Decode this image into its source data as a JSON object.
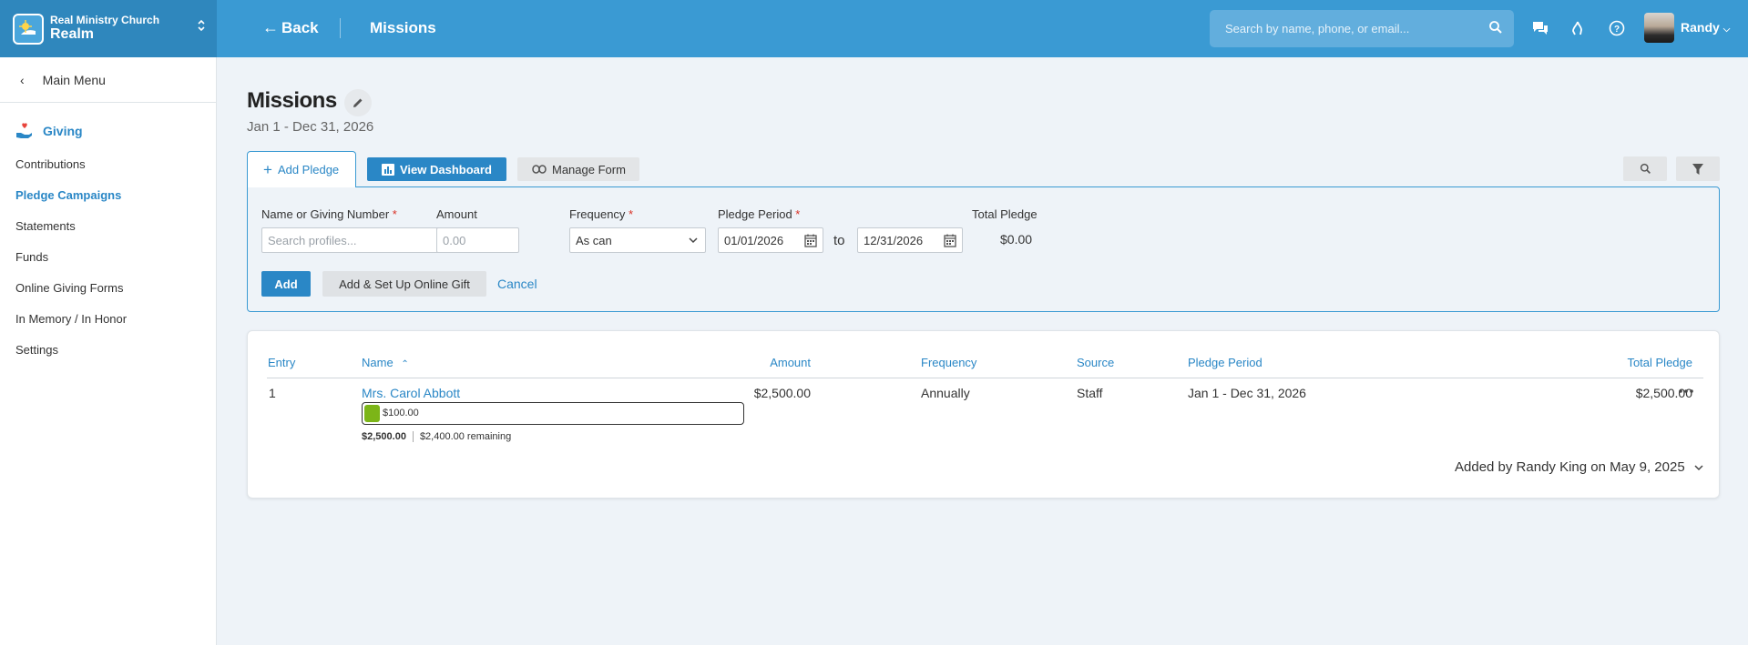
{
  "brand": {
    "org": "Real Ministry Church",
    "name": "Realm"
  },
  "topbar": {
    "back_label": "Back",
    "breadcrumb": "Missions",
    "search_placeholder": "Search by name, phone, or email...",
    "user_name": "Randy",
    "icons": [
      "message-icon",
      "prayer-hands-icon",
      "help-icon"
    ]
  },
  "sidebar": {
    "main_menu": "Main Menu",
    "section": "Giving",
    "items": [
      {
        "label": "Contributions"
      },
      {
        "label": "Pledge Campaigns",
        "active": true
      },
      {
        "label": "Statements"
      },
      {
        "label": "Funds"
      },
      {
        "label": "Online Giving Forms"
      },
      {
        "label": "In Memory / In Honor"
      },
      {
        "label": "Settings"
      }
    ]
  },
  "page": {
    "title": "Missions",
    "subtitle": "Jan 1 - Dec 31, 2026"
  },
  "toolbar": {
    "add_pledge": "Add Pledge",
    "view_dashboard": "View Dashboard",
    "manage_form": "Manage Form"
  },
  "form": {
    "name_label": "Name or Giving Number",
    "name_placeholder": "Search profiles...",
    "amount_label": "Amount",
    "amount_placeholder": "0.00",
    "frequency_label": "Frequency",
    "frequency_value": "As can",
    "period_label": "Pledge Period",
    "period_start": "01/01/2026",
    "to_label": "to",
    "period_end": "12/31/2026",
    "total_label": "Total Pledge",
    "total_value": "$0.00",
    "add_button": "Add",
    "add_setup_button": "Add & Set Up Online Gift",
    "cancel_button": "Cancel",
    "required_mark": "*"
  },
  "table": {
    "headers": {
      "entry": "Entry",
      "name": "Name",
      "amount": "Amount",
      "frequency": "Frequency",
      "source": "Source",
      "period": "Pledge Period",
      "total": "Total Pledge"
    },
    "rows": [
      {
        "entry": "1",
        "name": "Mrs. Carol Abbott",
        "amount": "$2,500.00",
        "frequency": "Annually",
        "source": "Staff",
        "period": "Jan 1 - Dec 31, 2026",
        "total": "$2,500.00",
        "given": "$100.00",
        "given_fraction": 0.04,
        "pledged": "$2,500.00",
        "remaining": "$2,400.00 remaining"
      }
    ],
    "added_by": "Added by Randy King on May 9, 2025"
  },
  "colors": {
    "accent": "#3a9ad3",
    "link": "#2a87c6",
    "progress": "#7cb518"
  }
}
